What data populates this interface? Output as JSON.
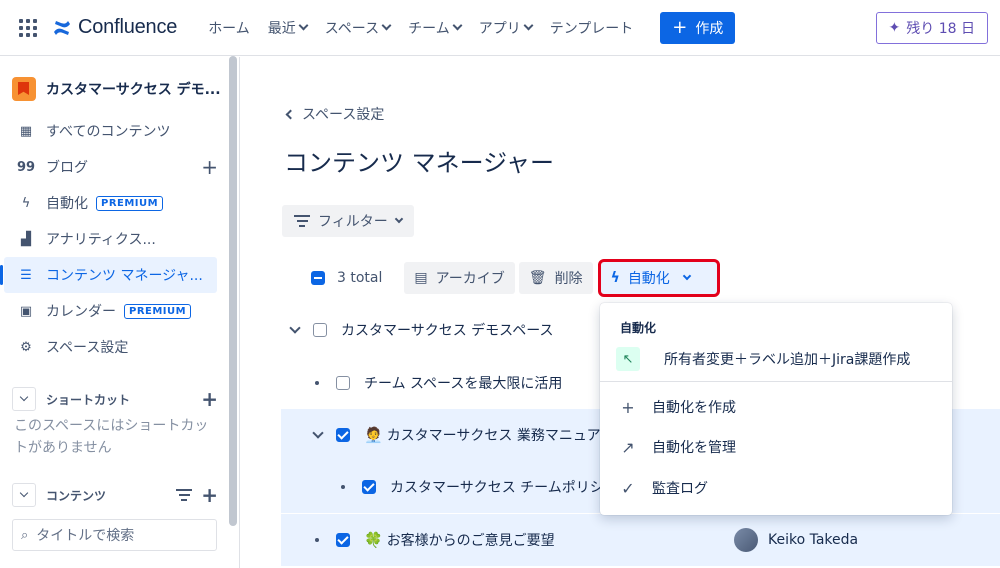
{
  "topbar": {
    "app_name": "Confluence",
    "nav": [
      "ホーム",
      "最近",
      "スペース",
      "チーム",
      "アプリ",
      "テンプレート"
    ],
    "create_label": "作成",
    "trial_label": "残り 18 日"
  },
  "sidebar": {
    "space_name": "カスタマーサクセス デモ...",
    "items": [
      {
        "label": "すべてのコンテンツ",
        "icon": "grid-icon"
      },
      {
        "label": "ブログ",
        "icon": "quote-icon"
      },
      {
        "label": "自動化",
        "icon": "lightning-icon",
        "badge": "PREMIUM"
      },
      {
        "label": "アナリティクス...",
        "icon": "bar-chart-icon"
      },
      {
        "label": "コンテンツ マネージャ...",
        "icon": "content-manager-icon"
      },
      {
        "label": "カレンダー",
        "icon": "calendar-icon",
        "badge": "PREMIUM"
      },
      {
        "label": "スペース設定",
        "icon": "gear-icon"
      }
    ],
    "shortcut_title": "ショートカット",
    "shortcut_empty": "このスペースにはショートカットがありません",
    "content_title": "コンテンツ",
    "search_placeholder": "タイトルで検索"
  },
  "main": {
    "back_label": "スペース設定",
    "title": "コンテンツ マネージャー",
    "filter_label": "フィルター",
    "toolbar": {
      "total": "3 total",
      "archive": "アーカイブ",
      "delete": "削除",
      "automation": "自動化"
    },
    "rows": [
      {
        "title": "カスタマーサクセス デモスペース",
        "checked": false
      },
      {
        "title": "チーム スペースを最大限に活用",
        "checked": false
      },
      {
        "title": "カスタマーサクセス 業務マニュア",
        "checked": true,
        "emoji": "🧑‍💼"
      },
      {
        "title": "カスタマーサクセス チームポリシ",
        "checked": true
      },
      {
        "title": "お客様からのご意見ご要望",
        "checked": true,
        "emoji": "🍀",
        "owner": "Keiko Takeda"
      }
    ]
  },
  "dropdown": {
    "heading": "自動化",
    "rule": "所有者変更＋ラベル追加＋Jira課題作成",
    "create": "自動化を作成",
    "manage": "自動化を管理",
    "audit": "監査ログ"
  }
}
